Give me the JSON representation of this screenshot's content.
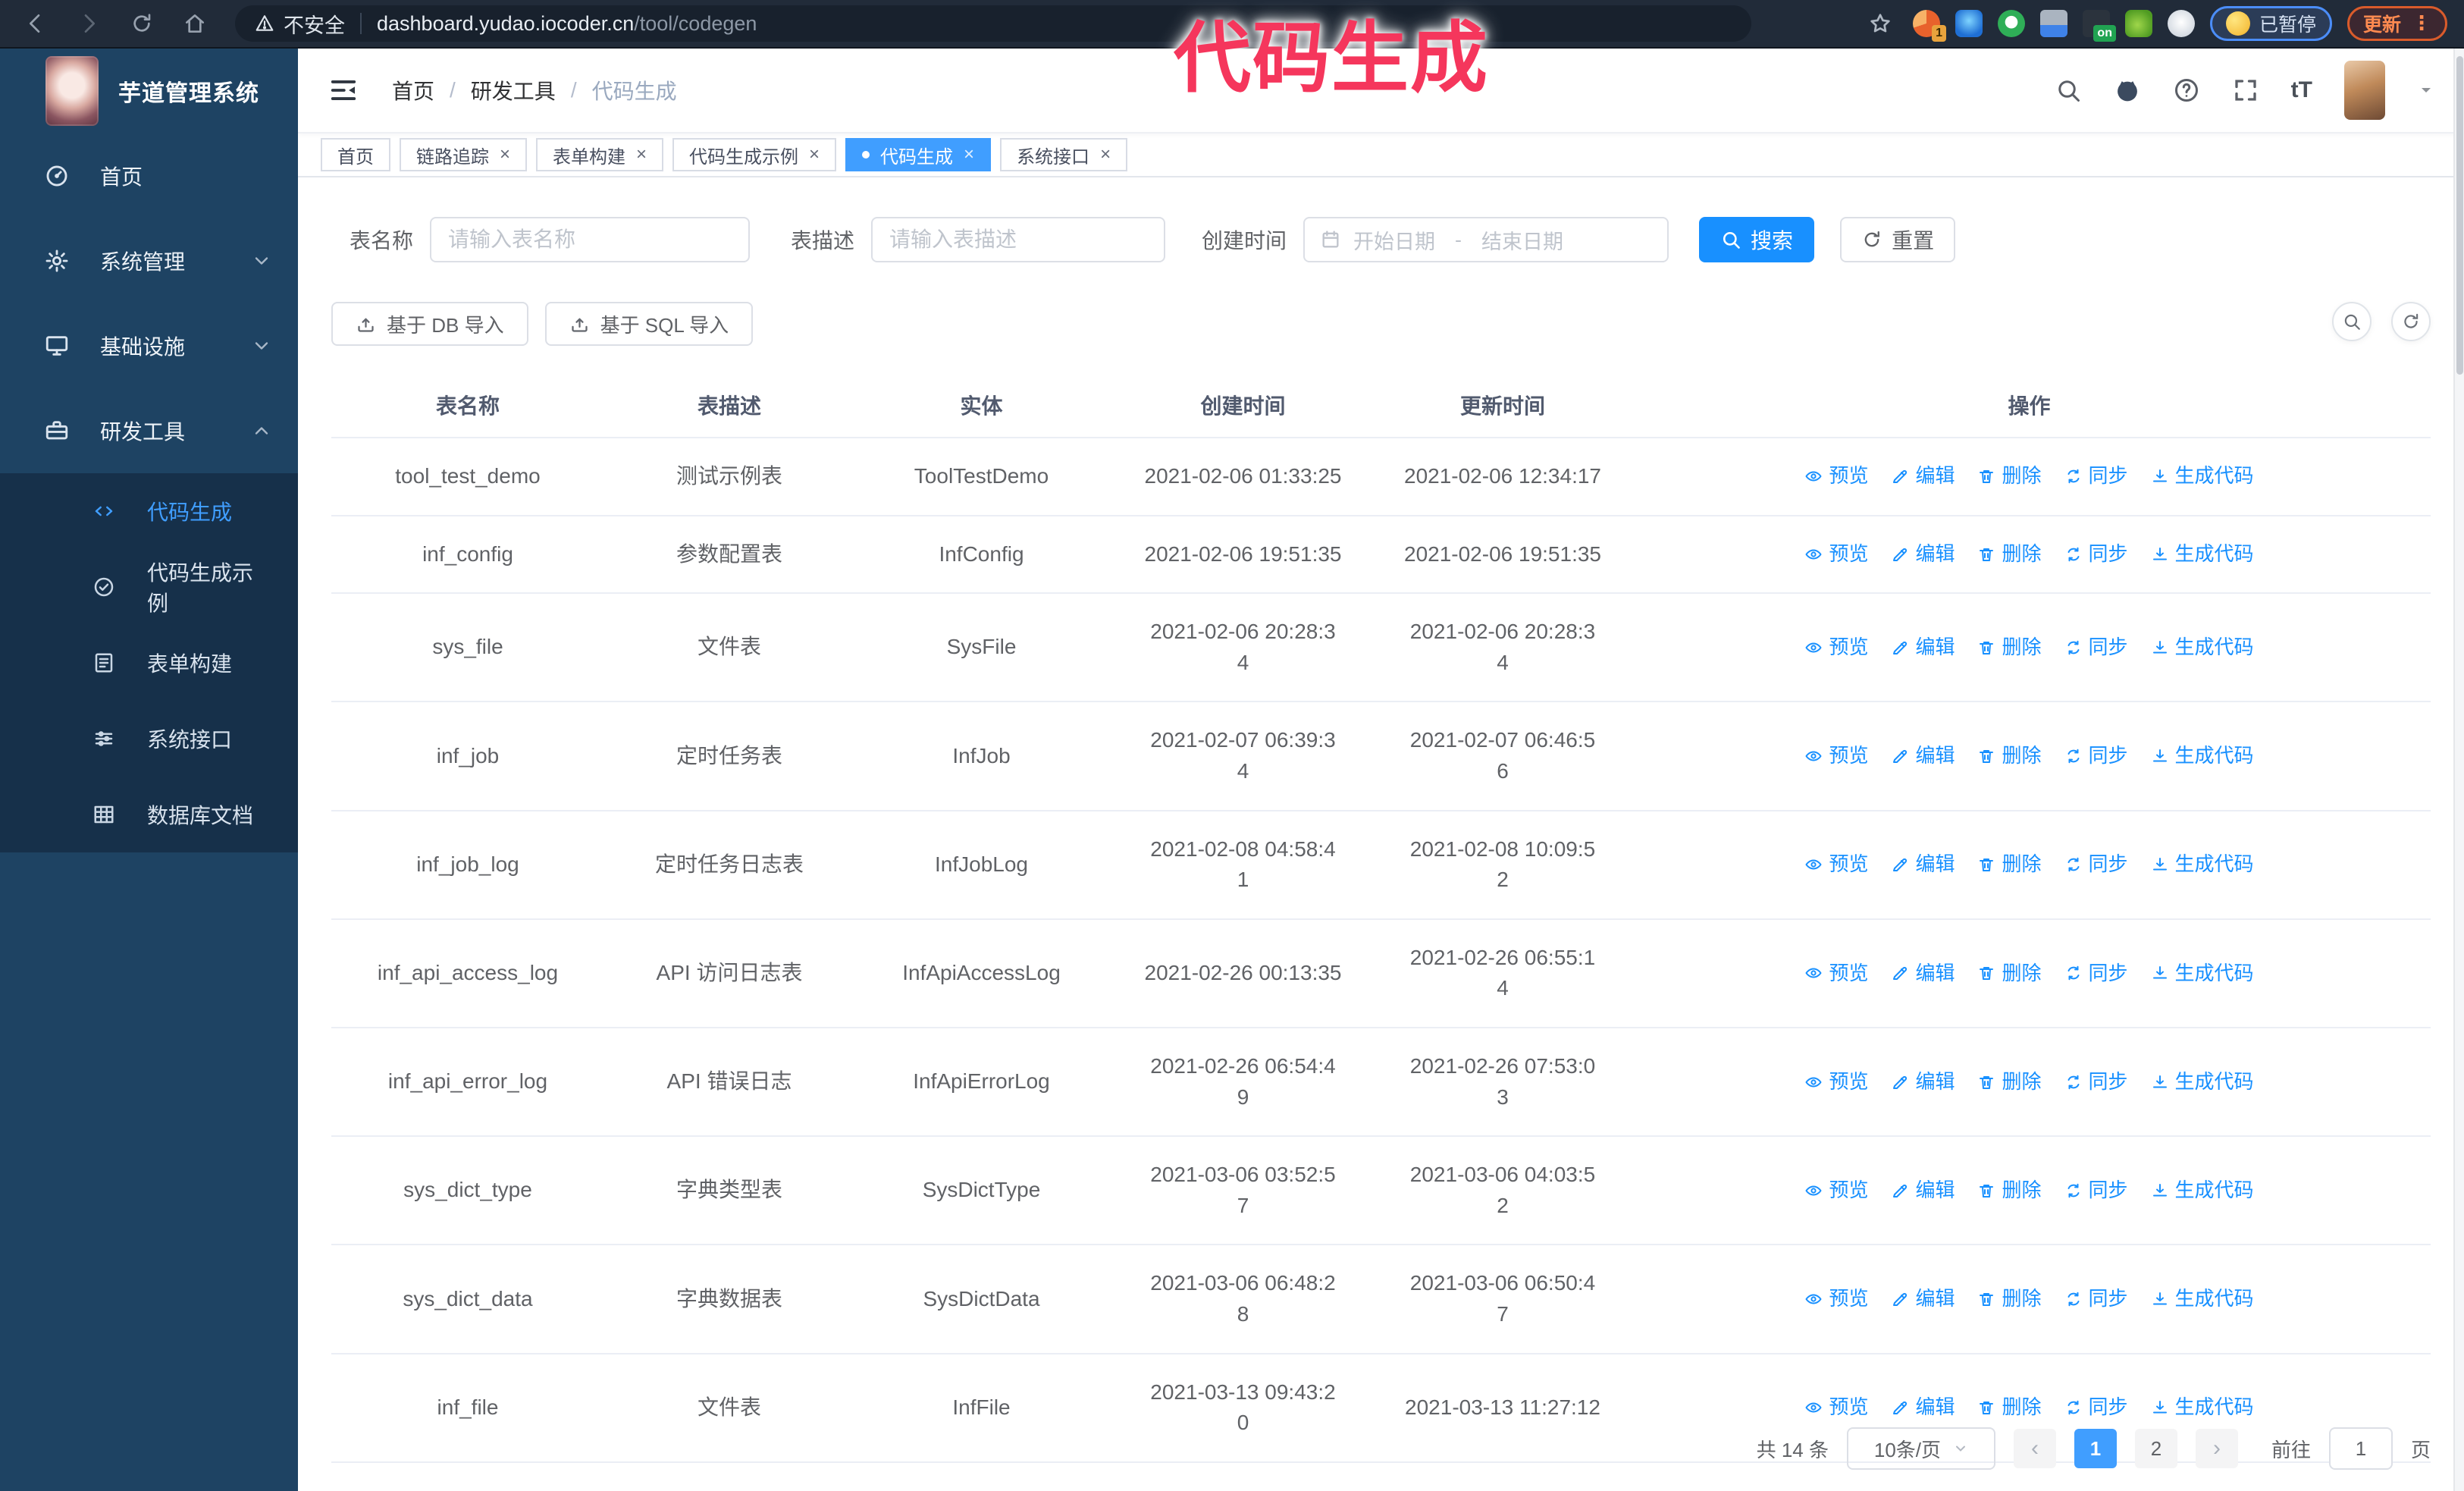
{
  "colors": {
    "accent": "#409eff",
    "primary_button": "#1890ff",
    "sidebar_bg": "#1e4363",
    "submenu_bg": "#16304a",
    "toolbar_bg": "#212b39",
    "link": "#1890ff",
    "overlay_text": "#f5365c"
  },
  "overlay_title": "代码生成",
  "browser": {
    "security_label": "不安全",
    "url_host": "dashboard.yudao.iocoder.cn",
    "url_path": "/tool/codegen",
    "extension_badge_count": "1",
    "extension_badge_on": "on",
    "paused_badge": "已暂停",
    "update_button": "更新",
    "kebab": "⋮"
  },
  "sidebar": {
    "logo_title": "芋道管理系统",
    "menu": [
      {
        "label": "首页",
        "icon": "dashboard-icon"
      },
      {
        "label": "系统管理",
        "icon": "gear-icon",
        "chevron": "down"
      },
      {
        "label": "基础设施",
        "icon": "infrastructure-icon",
        "chevron": "down"
      },
      {
        "label": "研发工具",
        "icon": "toolbox-icon",
        "chevron": "up",
        "expanded": true,
        "children": [
          {
            "label": "代码生成",
            "icon": "code-icon",
            "active": true
          },
          {
            "label": "代码生成示例",
            "icon": "example-check-icon"
          },
          {
            "label": "表单构建",
            "icon": "form-icon"
          },
          {
            "label": "系统接口",
            "icon": "api-icon"
          },
          {
            "label": "数据库文档",
            "icon": "database-icon"
          }
        ]
      }
    ]
  },
  "header": {
    "breadcrumb": [
      "首页",
      "研发工具",
      "代码生成"
    ],
    "separator": "/"
  },
  "tabs": [
    {
      "label": "首页",
      "closable": false,
      "active": false
    },
    {
      "label": "链路追踪",
      "closable": true,
      "active": false
    },
    {
      "label": "表单构建",
      "closable": true,
      "active": false
    },
    {
      "label": "代码生成示例",
      "closable": true,
      "active": false
    },
    {
      "label": "代码生成",
      "closable": true,
      "active": true
    },
    {
      "label": "系统接口",
      "closable": true,
      "active": false
    }
  ],
  "filters": {
    "name_label": "表名称",
    "name_placeholder": "请输入表名称",
    "desc_label": "表描述",
    "desc_placeholder": "请输入表描述",
    "time_label": "创建时间",
    "start_placeholder": "开始日期",
    "range_separator": "-",
    "end_placeholder": "结束日期",
    "search_label": "搜索",
    "reset_label": "重置"
  },
  "toolbar_buttons": {
    "import_db": "基于 DB 导入",
    "import_sql": "基于 SQL 导入"
  },
  "table": {
    "columns": [
      "表名称",
      "表描述",
      "实体",
      "创建时间",
      "更新时间",
      "操作"
    ],
    "op_labels": [
      {
        "label": "预览",
        "icon": "eye-icon"
      },
      {
        "label": "编辑",
        "icon": "edit-icon"
      },
      {
        "label": "删除",
        "icon": "delete-icon"
      },
      {
        "label": "同步",
        "icon": "sync-icon"
      },
      {
        "label": "生成代码",
        "icon": "generate-code-icon"
      }
    ],
    "rows": [
      {
        "name": "tool_test_demo",
        "description": "测试示例表",
        "entity": "ToolTestDemo",
        "created": "2021-02-06 01:33:25",
        "updated": "2021-02-06 12:34:17"
      },
      {
        "name": "inf_config",
        "description": "参数配置表",
        "entity": "InfConfig",
        "created": "2021-02-06 19:51:35",
        "updated": "2021-02-06 19:51:35"
      },
      {
        "name": "sys_file",
        "description": "文件表",
        "entity": "SysFile",
        "created": "2021-02-06 20:28:3\n4",
        "updated": "2021-02-06 20:28:3\n4"
      },
      {
        "name": "inf_job",
        "description": "定时任务表",
        "entity": "InfJob",
        "created": "2021-02-07 06:39:3\n4",
        "updated": "2021-02-07 06:46:5\n6"
      },
      {
        "name": "inf_job_log",
        "description": "定时任务日志表",
        "entity": "InfJobLog",
        "created": "2021-02-08 04:58:4\n1",
        "updated": "2021-02-08 10:09:5\n2"
      },
      {
        "name": "inf_api_access_log",
        "description": "API 访问日志表",
        "entity": "InfApiAccessLog",
        "created": "2021-02-26 00:13:35",
        "updated": "2021-02-26 06:55:1\n4"
      },
      {
        "name": "inf_api_error_log",
        "description": "API 错误日志",
        "entity": "InfApiErrorLog",
        "created": "2021-02-26 06:54:4\n9",
        "updated": "2021-02-26 07:53:0\n3"
      },
      {
        "name": "sys_dict_type",
        "description": "字典类型表",
        "entity": "SysDictType",
        "created": "2021-03-06 03:52:5\n7",
        "updated": "2021-03-06 04:03:5\n2"
      },
      {
        "name": "sys_dict_data",
        "description": "字典数据表",
        "entity": "SysDictData",
        "created": "2021-03-06 06:48:2\n8",
        "updated": "2021-03-06 06:50:4\n7"
      },
      {
        "name": "inf_file",
        "description": "文件表",
        "entity": "InfFile",
        "created": "2021-03-13 09:43:2\n0",
        "updated": "2021-03-13 11:27:12"
      }
    ]
  },
  "pagination": {
    "total": "共 14 条",
    "page_size": "10条/页",
    "prev": "‹",
    "next": "›",
    "pages": [
      "1",
      "2"
    ],
    "active_page": "1",
    "goto_label": "前往",
    "goto_value": "1",
    "goto_unit": "页"
  }
}
